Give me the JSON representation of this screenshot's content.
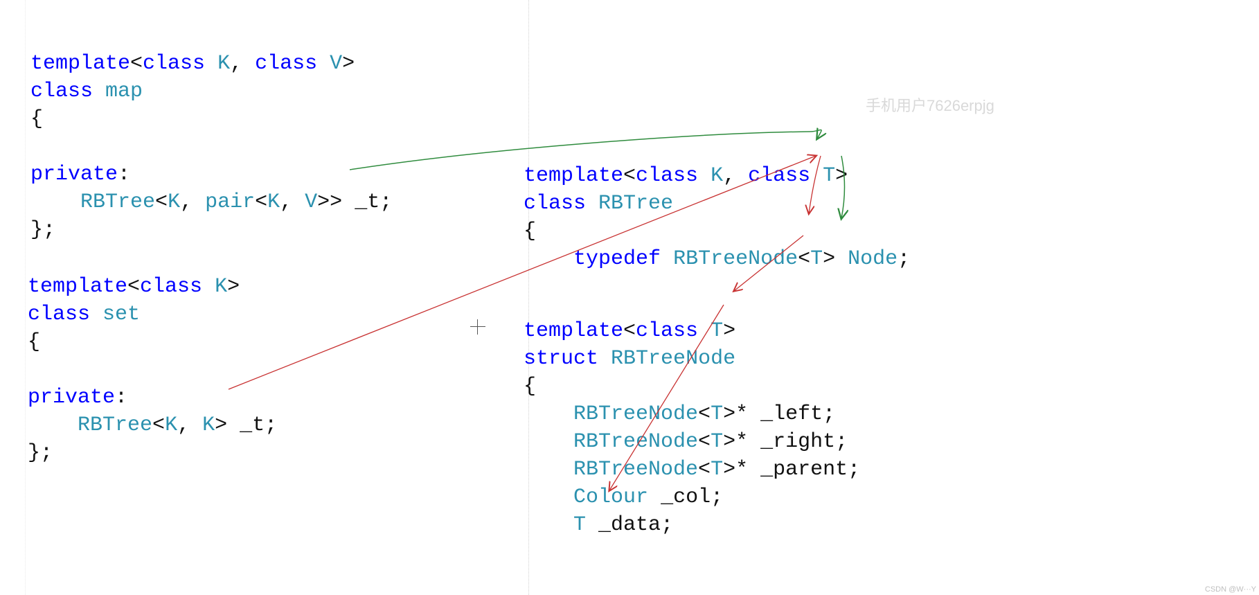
{
  "watermarks": {
    "top_right": "手机用户7626erpjg",
    "bottom_right": "CSDN @W···Y"
  },
  "left_code": {
    "map_block": {
      "line1": {
        "kw1": "template",
        "angle1": "<",
        "kw2": "class",
        "sp1": " ",
        "id1": "K",
        "comma1": ", ",
        "kw3": "class",
        "sp2": " ",
        "id2": "V",
        "angle2": ">"
      },
      "line2": {
        "kw1": "class",
        "sp1": " ",
        "id1": "map"
      },
      "line3": "{",
      "line4": "",
      "line5": {
        "kw1": "private",
        "colon": ":"
      },
      "line6": {
        "indent": "    ",
        "id1": "RBTree",
        "angle1": "<",
        "id2": "K",
        "comma1": ", ",
        "id3": "pair",
        "angle2": "<",
        "id4": "K",
        "comma2": ", ",
        "id5": "V",
        "angle3": ">>",
        "sp1": " ",
        "var": "_t",
        "semi": ";"
      },
      "line7": "};"
    },
    "set_block": {
      "line1": {
        "kw1": "template",
        "angle1": "<",
        "kw2": "class",
        "sp1": " ",
        "id1": "K",
        "angle2": ">"
      },
      "line2": {
        "kw1": "class",
        "sp1": " ",
        "id1": "set"
      },
      "line3": "{",
      "line4": "",
      "line5": {
        "kw1": "private",
        "colon": ":"
      },
      "line6": {
        "indent": "    ",
        "id1": "RBTree",
        "angle1": "<",
        "id2": "K",
        "comma1": ", ",
        "id3": "K",
        "angle2": ">",
        "sp1": " ",
        "var": "_t",
        "semi": ";"
      },
      "line7": "};"
    }
  },
  "right_code": {
    "rbtree_block": {
      "line1": {
        "kw1": "template",
        "angle1": "<",
        "kw2": "class",
        "sp1": " ",
        "id1": "K",
        "comma1": ", ",
        "kw3": "class",
        "sp2": " ",
        "id2": "T",
        "angle2": ">"
      },
      "line2": {
        "kw1": "class",
        "sp1": " ",
        "id1": "RBTree"
      },
      "line3": "{",
      "line4": {
        "indent": "    ",
        "kw1": "typedef",
        "sp1": " ",
        "id1": "RBTreeNode",
        "angle1": "<",
        "id2": "T",
        "angle2": ">",
        "sp2": " ",
        "id3": "Node",
        "semi": ";"
      }
    },
    "node_block": {
      "line1": {
        "kw1": "template",
        "angle1": "<",
        "kw2": "class",
        "sp1": " ",
        "id1": "T",
        "angle2": ">"
      },
      "line2": {
        "kw1": "struct",
        "sp1": " ",
        "id1": "RBTreeNode"
      },
      "line3": "{",
      "line4": {
        "indent": "    ",
        "id1": "RBTreeNode",
        "angle1": "<",
        "id2": "T",
        "angle2": ">*",
        "sp1": " ",
        "var": "_left",
        "semi": ";"
      },
      "line5": {
        "indent": "    ",
        "id1": "RBTreeNode",
        "angle1": "<",
        "id2": "T",
        "angle2": ">*",
        "sp1": " ",
        "var": "_right",
        "semi": ";"
      },
      "line6": {
        "indent": "    ",
        "id1": "RBTreeNode",
        "angle1": "<",
        "id2": "T",
        "angle2": ">*",
        "sp1": " ",
        "var": "_parent",
        "semi": ";"
      },
      "line7": {
        "indent": "    ",
        "id1": "Colour",
        "sp1": " ",
        "var": "_col",
        "semi": ";"
      },
      "line8": {
        "indent": "    ",
        "id1": "T",
        "sp1": " ",
        "var": "_data",
        "semi": ";"
      }
    }
  },
  "arrows": {
    "colors": {
      "green": "#2e8b3d",
      "red": "#c83232"
    },
    "segments": [
      {
        "type": "curve-green-top"
      },
      {
        "type": "line-green-down-to-T"
      },
      {
        "type": "line-red-set-to-T"
      },
      {
        "type": "line-red-T-to-NodeT"
      },
      {
        "type": "line-red-templateT-to-data"
      }
    ]
  }
}
